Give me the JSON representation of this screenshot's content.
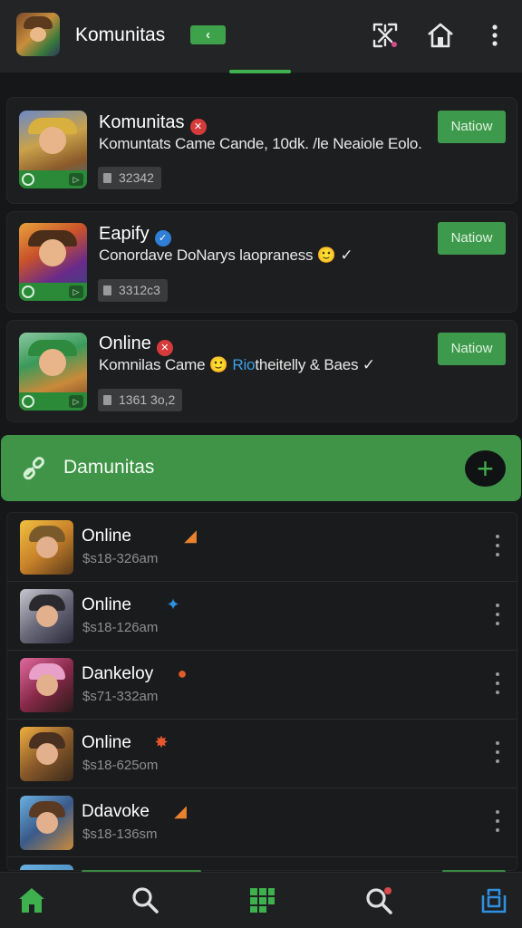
{
  "header": {
    "title": "Komunitas",
    "back_label": "‹"
  },
  "featured": [
    {
      "title": "Komunitas",
      "badge": "✕",
      "badge_color": "#d63b3b",
      "description": "Komuntats Came Cande, 10dk. /le Neaiole Eolo.",
      "highlight": "",
      "description_tail": "",
      "stat": "32342",
      "button": "Natiow"
    },
    {
      "title": "Eapify",
      "badge": "✓",
      "badge_color": "#2f7fd6",
      "description": "Conordave DoNarys laopraness ",
      "highlight": "",
      "description_tail": "🙂 ✓",
      "stat": "3312c3",
      "button": "Natiow"
    },
    {
      "title": "Online",
      "badge": "✕",
      "badge_color": "#d63b3b",
      "description": "Komnilas Came 🙂 ",
      "highlight": "Rio",
      "description_tail": "theitelly & Baes ✓",
      "stat": "1361 3o,2",
      "button": "Natiow"
    }
  ],
  "section": {
    "title": "Damunitas",
    "add_label": "+"
  },
  "list": [
    {
      "name": "Online",
      "time": "$s18-326am",
      "icon": "◢",
      "icon_color": "#e8822e"
    },
    {
      "name": "Online",
      "time": "$s18-126am",
      "icon": "✦",
      "icon_color": "#2f8fe0"
    },
    {
      "name": "Dankeloy",
      "time": "$s71-332am",
      "icon": "●",
      "icon_color": "#e05a2a"
    },
    {
      "name": "Online",
      "time": "$s18-625om",
      "icon": "✸",
      "icon_color": "#e8562e"
    },
    {
      "name": "Ddavoke",
      "time": "$s18-136sm",
      "icon": "◢",
      "icon_color": "#e8822e"
    }
  ],
  "nav": {
    "home_color": "#3eb04e",
    "accent_color": "#2f8fe0"
  }
}
